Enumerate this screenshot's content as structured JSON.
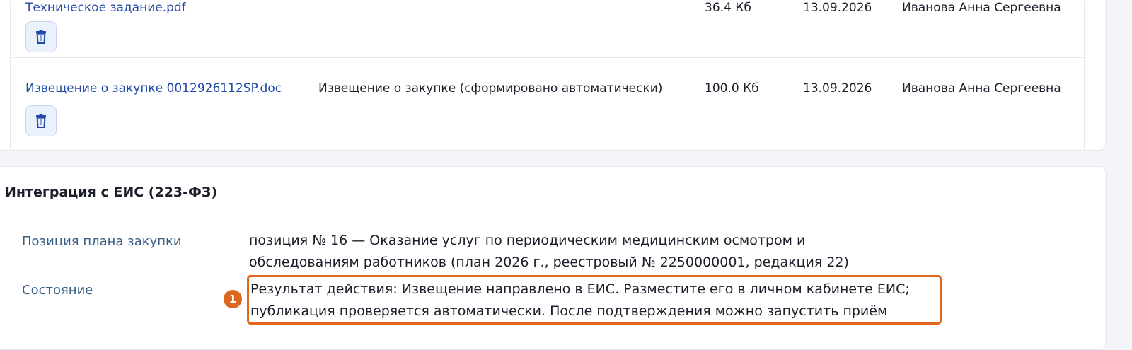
{
  "files": {
    "rows": [
      {
        "name": "Техническое задание.pdf",
        "description": "",
        "size": "36.4 Кб",
        "date": "13.09.2026",
        "author": "Иванова Анна Сергеевна"
      },
      {
        "name": "Извещение о закупке 0012926112SP.doc",
        "description": "Извещение о закупке (сформировано автоматически)",
        "size": "100.0 Кб",
        "date": "13.09.2026",
        "author": "Иванова Анна Сергеевна"
      }
    ],
    "delete_icon": "trash-icon"
  },
  "eis": {
    "title": "Интеграция с ЕИС (223-ФЗ)",
    "plan_label": "Позиция плана закупки",
    "plan_value_line1": "позиция № 16 — Оказание услуг по периодическим медицинским осмотром и",
    "plan_value_line2": "обследованиям работников (план 2026 г., реестровый № 2250000001, редакция 22)",
    "state_label": "Состояние",
    "state_line1": "Результат действия: Извещение направлено в ЕИС. Разместите его в личном кабинете ЕИС;",
    "state_line2": "публикация проверяется автоматически. После подтверждения можно запустить приём"
  },
  "annotation": {
    "marker": "1",
    "color": "#e0661f"
  },
  "colors": {
    "link": "#1f4aa8",
    "label": "#3a5f86",
    "button_bg": "#eaf1fc"
  }
}
